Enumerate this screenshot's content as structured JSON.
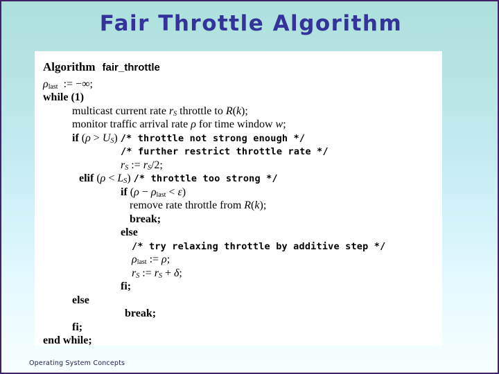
{
  "slide": {
    "title": "Fair Throttle Algorithm",
    "footer": "Operating System Concepts",
    "title_color": "#333399",
    "background_top_color": "#ade0dd",
    "background_bottom_color": "#f7feff",
    "border_color": "#42216b",
    "panel_color": "#ffffff"
  },
  "algorithm": {
    "header_keyword": "Algorithm",
    "header_name": "fair_throttle",
    "lines": [
      {
        "indent": 0,
        "text": "ρlast := −∞;"
      },
      {
        "indent": 0,
        "text": "while (1)"
      },
      {
        "indent": 1,
        "text": "multicast current rate rS throttle to R(k);"
      },
      {
        "indent": 1,
        "text": "monitor traffic arrival rate ρ for time window w;"
      },
      {
        "indent": 1,
        "text": "if (ρ > US) /* throttle not strong enough */"
      },
      {
        "indent": 3,
        "text": "/* further restrict throttle rate */"
      },
      {
        "indent": 3,
        "text": "rS := rS/2;"
      },
      {
        "indent": 1,
        "text": "elif (ρ < LS) /* throttle too strong */"
      },
      {
        "indent": 3,
        "text": "if (ρ − ρlast < ε)"
      },
      {
        "indent": 4,
        "text": "remove rate throttle from R(k);"
      },
      {
        "indent": 4,
        "text": "break;"
      },
      {
        "indent": 3,
        "text": "else"
      },
      {
        "indent": 4,
        "text": "/* try relaxing throttle by additive step */"
      },
      {
        "indent": 4,
        "text": "ρlast := ρ;"
      },
      {
        "indent": 4,
        "text": "rS := rS + δ;"
      },
      {
        "indent": 3,
        "text": "fi;"
      },
      {
        "indent": 1,
        "text": "else"
      },
      {
        "indent": 3,
        "text": "break;"
      },
      {
        "indent": 1,
        "text": "fi;"
      },
      {
        "indent": 0,
        "text": "end while;"
      }
    ]
  }
}
